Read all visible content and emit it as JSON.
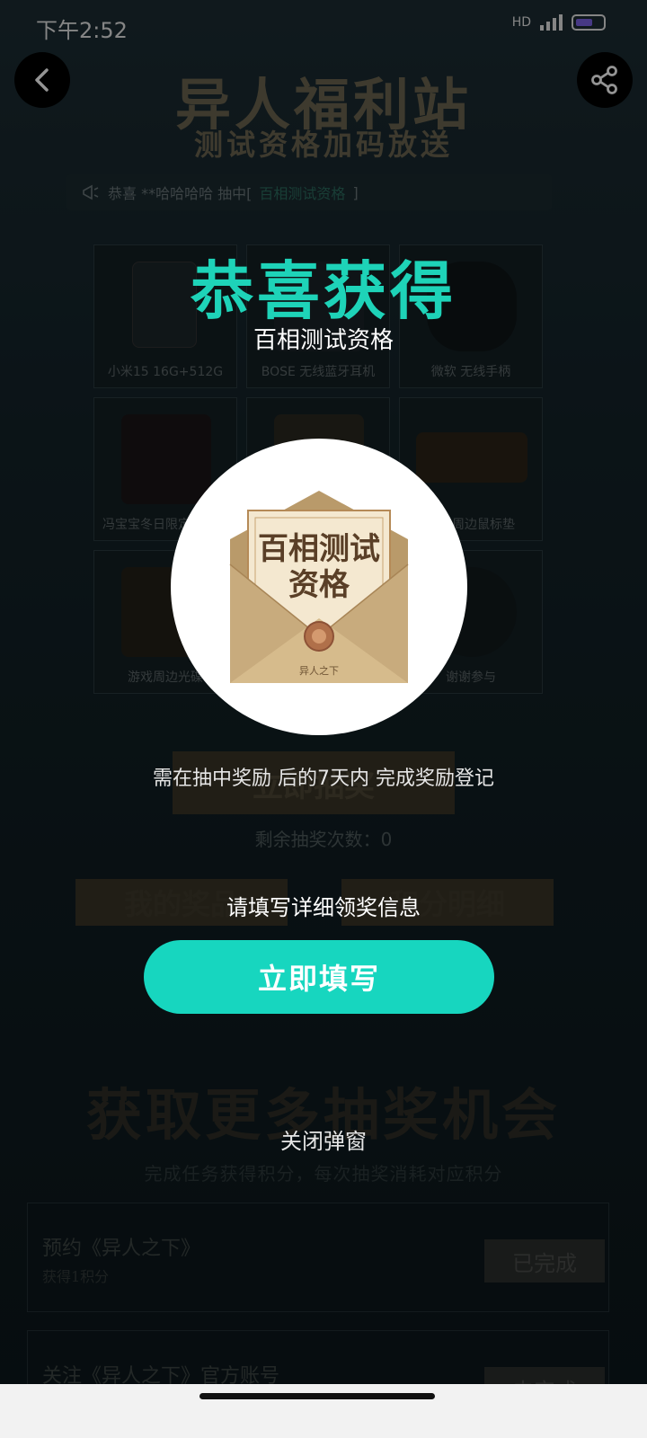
{
  "status_bar": {
    "time": "下午2:52",
    "network": "HD",
    "battery": "41"
  },
  "header": {
    "title": "异人福利站",
    "subtitle": "测试资格加码放送"
  },
  "ticker": {
    "prefix": "恭喜 **哈哈哈哈 抽中[",
    "prize": "百相测试资格",
    "suffix": "]"
  },
  "prize_grid": [
    {
      "label": "小米15 16G+512G"
    },
    {
      "label": "BOSE 无线蓝牙耳机"
    },
    {
      "label": "微软 无线手柄"
    },
    {
      "label": "冯宝宝冬日限定自行车"
    },
    {
      "label": ""
    },
    {
      "label": "游戏周边鼠标垫"
    },
    {
      "label": "游戏周边光碟"
    },
    {
      "label": ""
    },
    {
      "label": "谢谢参与"
    }
  ],
  "draw": {
    "button_label": "立即抽奖",
    "remaining": "剩余抽奖次数：0"
  },
  "bottom_buttons": {
    "my_prizes": "我的奖品",
    "points_detail": "积分明细"
  },
  "more_chances": {
    "title": "获取更多抽奖机会",
    "subtitle": "完成任务获得积分，每次抽奖消耗对应积分"
  },
  "tasks": [
    {
      "title": "预约《异人之下》",
      "sub": "获得1积分",
      "button": "已完成"
    },
    {
      "title": "关注《异人之下》官方账号",
      "sub": "",
      "button": "去完成"
    }
  ],
  "modal": {
    "title": "恭喜获得",
    "prize_name": "百相测试资格",
    "envelope_text_line1": "百相测试",
    "envelope_text_line2": "资格",
    "envelope_footer": "异人之下",
    "note": "需在抽中奖励 后的7天内 完成奖励登记",
    "fill_info": "请填写详细领奖信息",
    "fill_button": "立即填写",
    "close_button": "关闭弹窗"
  },
  "colors": {
    "accent": "#17d6bf",
    "title_accent": "#1ed3b8",
    "bg": "#0f1a1f"
  }
}
